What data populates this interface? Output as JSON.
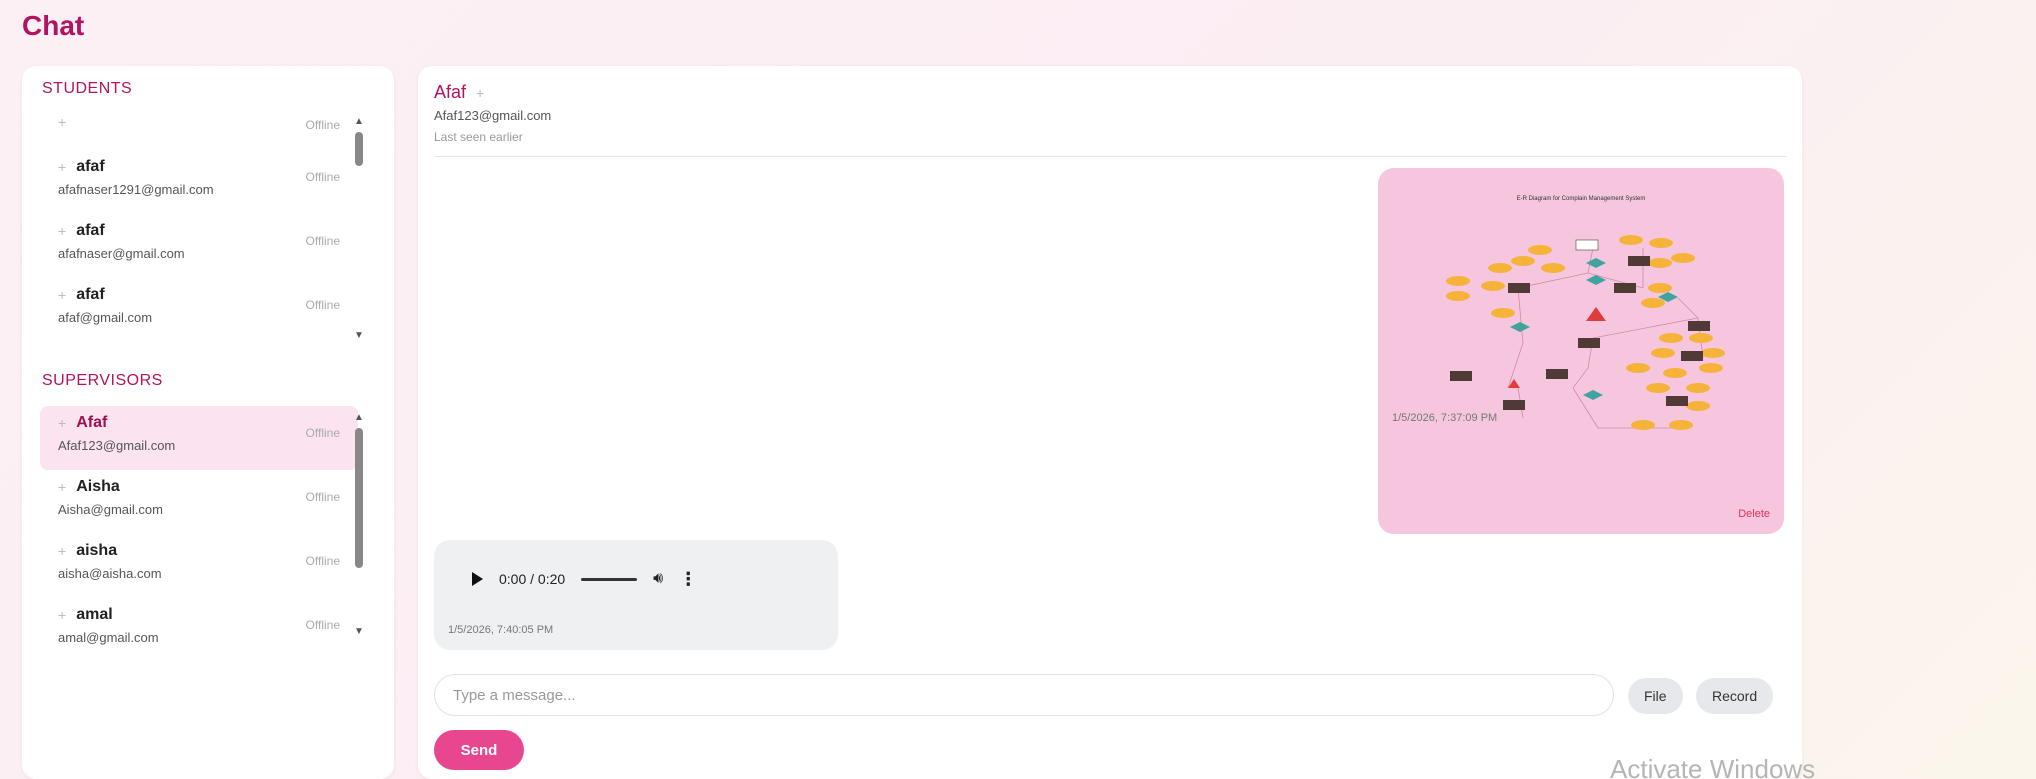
{
  "page": {
    "title": "Chat"
  },
  "students": {
    "heading": "STUDENTS",
    "items": [
      {
        "name": "",
        "email": "",
        "status": "Offline"
      },
      {
        "name": "afaf",
        "email": "afafnaser1291@gmail.com",
        "status": "Offline"
      },
      {
        "name": "afaf",
        "email": "afafnaser@gmail.com",
        "status": "Offline"
      },
      {
        "name": "afaf",
        "email": "afaf@gmail.com",
        "status": "Offline"
      }
    ]
  },
  "supervisors": {
    "heading": "SUPERVISORS",
    "items": [
      {
        "name": "Afaf",
        "email": "Afaf123@gmail.com",
        "status": "Offline",
        "active": true
      },
      {
        "name": "Aisha",
        "email": "Aisha@gmail.com",
        "status": "Offline"
      },
      {
        "name": "aisha",
        "email": "aisha@aisha.com",
        "status": "Offline"
      },
      {
        "name": "amal",
        "email": "amal@gmail.com",
        "status": "Offline"
      }
    ]
  },
  "chat": {
    "contact_name": "Afaf",
    "contact_email": "Afaf123@gmail.com",
    "last_seen": "Last seen earlier",
    "image_message": {
      "caption": "E-R Diagram for Complain Management System",
      "timestamp": "1/5/2026, 7:37:09 PM",
      "delete_label": "Delete"
    },
    "audio_message": {
      "time_display": "0:00 / 0:20",
      "timestamp": "1/5/2026, 7:40:05 PM"
    },
    "input_placeholder": "Type a message...",
    "file_label": "File",
    "record_label": "Record",
    "send_label": "Send"
  },
  "watermark": "Activate Windows",
  "colors": {
    "accent": "#b3125e",
    "send": "#e8478f",
    "bubble_pink": "#f6c6de",
    "bubble_gray": "#eef0f2"
  },
  "icons": {
    "play": "play-icon",
    "volume": "volume-icon",
    "more": "kebab-icon",
    "status_dot": "dot-icon"
  }
}
